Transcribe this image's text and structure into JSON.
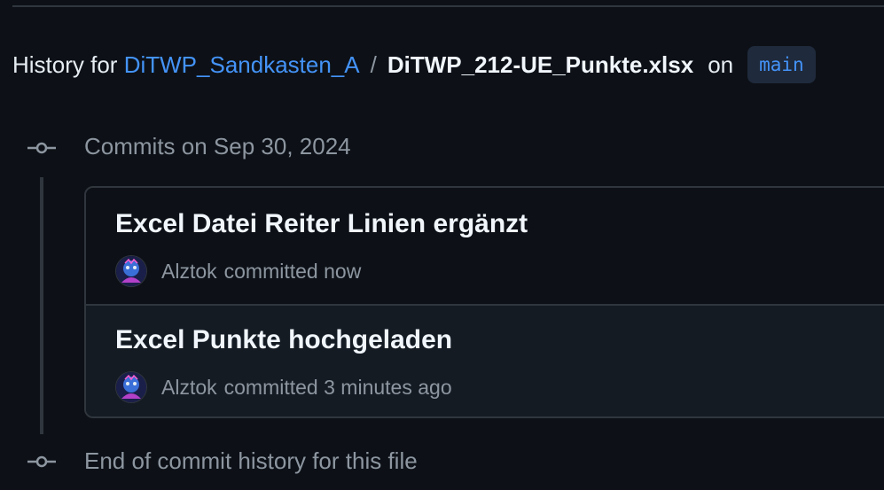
{
  "heading": {
    "prefix": "History for",
    "repo": "DiTWP_Sandkasten_A",
    "separator": "/",
    "filename": "DiTWP_212-UE_Punkte.xlsx",
    "on": "on",
    "branch": "main"
  },
  "group": {
    "date_label": "Commits on Sep 30, 2024"
  },
  "commits": [
    {
      "title": "Excel Datei Reiter Linien ergänzt",
      "author": "Alztok",
      "action": "committed",
      "time": "now"
    },
    {
      "title": "Excel Punkte hochgeladen",
      "author": "Alztok",
      "action": "committed",
      "time": "3 minutes ago"
    }
  ],
  "footer": {
    "end_label": "End of commit history for this file"
  },
  "colors": {
    "background": "#0d1117",
    "link": "#4493f8",
    "muted": "#8d96a0",
    "border": "#30363d"
  },
  "icons": {
    "timeline_node": "git-commit-icon",
    "avatar": "user-avatar"
  }
}
